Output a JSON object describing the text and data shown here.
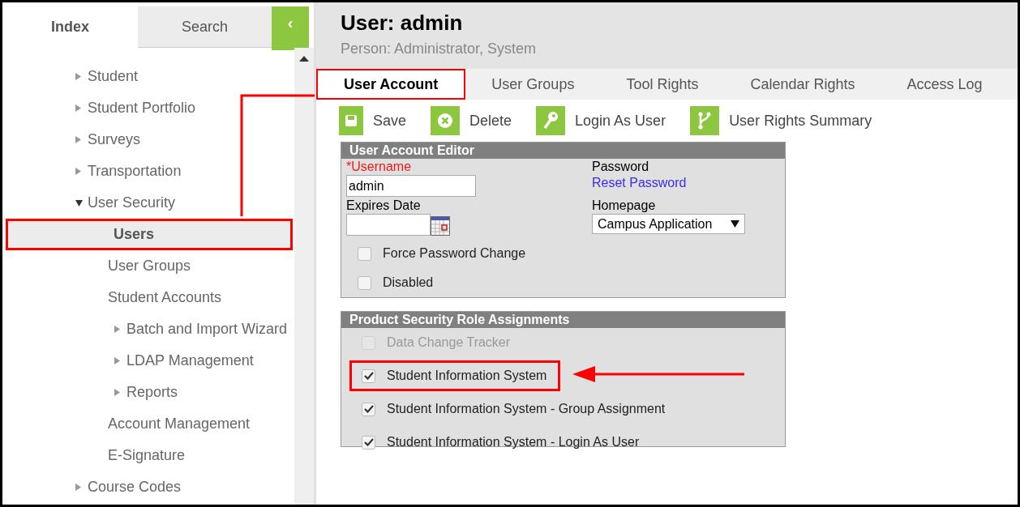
{
  "sidebar": {
    "tabs": [
      {
        "label": "Index",
        "selected": true
      },
      {
        "label": "Search",
        "selected": false
      }
    ],
    "collapse_button": "‹",
    "tree": [
      {
        "label": "Student",
        "kind": "folder",
        "expanded": false,
        "selected": false,
        "highlighted": false
      },
      {
        "label": "Student Portfolio",
        "kind": "folder",
        "expanded": false,
        "selected": false,
        "highlighted": false
      },
      {
        "label": "Surveys",
        "kind": "folder",
        "expanded": false,
        "selected": false,
        "highlighted": false
      },
      {
        "label": "Transportation",
        "kind": "folder",
        "expanded": false,
        "selected": false,
        "highlighted": false
      },
      {
        "label": "User Security",
        "kind": "folder",
        "expanded": true,
        "selected": false,
        "highlighted": false,
        "children": [
          {
            "label": "Users",
            "kind": "page",
            "selected": true,
            "highlighted": true
          },
          {
            "label": "User Groups",
            "kind": "page",
            "selected": false,
            "highlighted": false
          },
          {
            "label": "Student Accounts",
            "kind": "page",
            "selected": false,
            "highlighted": false
          },
          {
            "label": "Batch and Import Wizard",
            "kind": "folder",
            "expanded": false,
            "selected": false,
            "highlighted": false
          },
          {
            "label": "LDAP Management",
            "kind": "folder",
            "expanded": false,
            "selected": false,
            "highlighted": false
          },
          {
            "label": "Reports",
            "kind": "folder",
            "expanded": false,
            "selected": false,
            "highlighted": false
          },
          {
            "label": "Account Management",
            "kind": "page",
            "selected": false,
            "highlighted": false
          },
          {
            "label": "E-Signature",
            "kind": "page",
            "selected": false,
            "highlighted": false
          }
        ]
      },
      {
        "label": "Course Codes",
        "kind": "folder",
        "expanded": false,
        "selected": false,
        "highlighted": false
      }
    ]
  },
  "header": {
    "title": "User: admin",
    "subtitle": "Person: Administrator, System"
  },
  "tabs": [
    {
      "label": "User Account",
      "selected": true,
      "highlighted": true
    },
    {
      "label": "User Groups",
      "selected": false,
      "highlighted": false
    },
    {
      "label": "Tool Rights",
      "selected": false,
      "highlighted": false
    },
    {
      "label": "Calendar Rights",
      "selected": false,
      "highlighted": false
    },
    {
      "label": "Access Log",
      "selected": false,
      "highlighted": false
    }
  ],
  "toolbar": [
    {
      "label": "Save",
      "kind": "save"
    },
    {
      "label": "Delete",
      "kind": "delete"
    },
    {
      "label": "Login As User",
      "kind": "key"
    },
    {
      "label": "User Rights Summary",
      "kind": "branch"
    }
  ],
  "editor": {
    "title": "User Account Editor",
    "username_label": "*Username",
    "username": "admin",
    "expires_label": "Expires Date",
    "password_label": "Password",
    "reset_link": "Reset Password",
    "homepage_label": "Homepage",
    "homepage": "Campus Application",
    "checkboxes": [
      {
        "label": "Force Password Change",
        "checked": false
      },
      {
        "label": "Disabled",
        "checked": false
      }
    ]
  },
  "roles": {
    "title": "Product Security Role Assignments",
    "items": [
      {
        "label": "Data Change Tracker",
        "checked": false,
        "disabled": true,
        "highlighted": false
      },
      {
        "label": "Student Information System",
        "checked": true,
        "disabled": false,
        "highlighted": true
      },
      {
        "label": "Student Information System - Group Assignment",
        "checked": true,
        "disabled": false,
        "highlighted": false
      },
      {
        "label": "Student Information System - Login As User",
        "checked": true,
        "disabled": false,
        "highlighted": false
      }
    ]
  }
}
